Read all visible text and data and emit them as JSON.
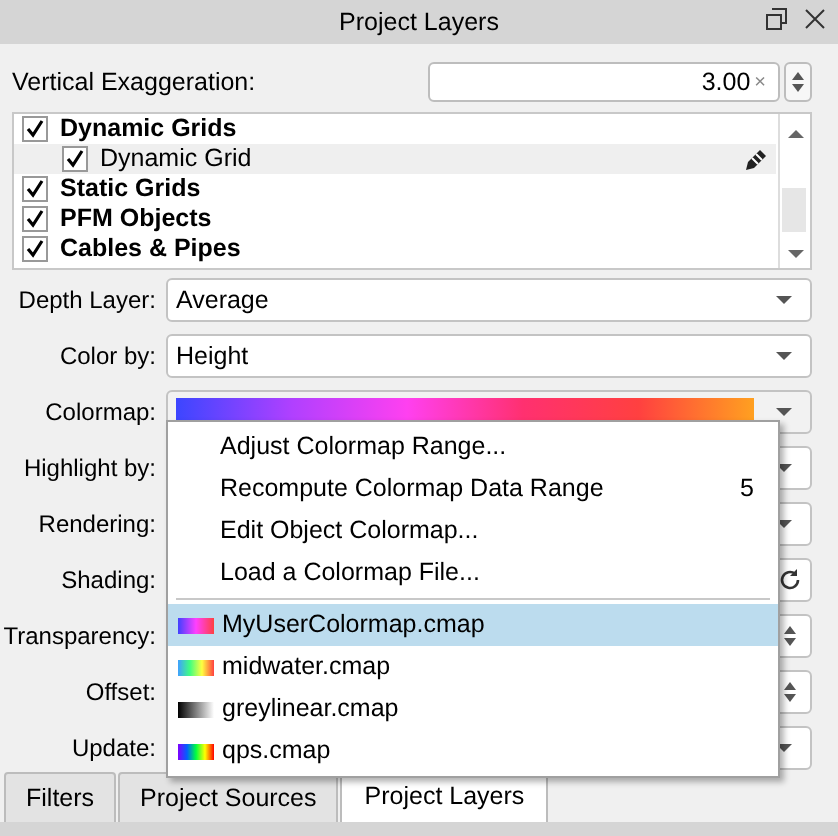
{
  "window": {
    "title": "Project Layers"
  },
  "vertical_exaggeration": {
    "label": "Vertical Exaggeration:",
    "value": "3.00",
    "suffix": "×"
  },
  "layers": [
    {
      "label": "Dynamic Grids",
      "checked": true,
      "selected": false,
      "children": [
        {
          "label": "Dynamic Grid",
          "checked": true,
          "selected": true,
          "editable": true
        }
      ]
    },
    {
      "label": "Static Grids",
      "checked": true,
      "selected": false
    },
    {
      "label": "PFM Objects",
      "checked": true,
      "selected": false
    },
    {
      "label": "Cables & Pipes",
      "checked": true,
      "selected": false
    }
  ],
  "fields": [
    {
      "label": "Depth Layer:",
      "kind": "select",
      "value": "Average"
    },
    {
      "label": "Color by:",
      "kind": "select",
      "value": "Height"
    },
    {
      "label": "Colormap:",
      "kind": "colormap"
    },
    {
      "label": "Highlight by:",
      "kind": "select"
    },
    {
      "label": "Rendering:",
      "kind": "select"
    },
    {
      "label": "Shading:",
      "kind": "refresh"
    },
    {
      "label": "Transparency:",
      "kind": "spin"
    },
    {
      "label": "Offset:",
      "kind": "spin"
    },
    {
      "label": "Update:",
      "kind": "select"
    }
  ],
  "colormap_menu": {
    "actions": [
      {
        "label": "Adjust Colormap Range..."
      },
      {
        "label": "Recompute Colormap Data Range",
        "shortcut": "5"
      },
      {
        "label": "Edit Object Colormap..."
      },
      {
        "label": "Load a Colormap File..."
      }
    ],
    "files": [
      {
        "label": "MyUserColormap.cmap",
        "selected": true,
        "kind": "magenta"
      },
      {
        "label": "midwater.cmap",
        "selected": false,
        "kind": "spectrum"
      },
      {
        "label": "greylinear.cmap",
        "selected": false,
        "kind": "grey"
      },
      {
        "label": "qps.cmap",
        "selected": false,
        "kind": "rainbow"
      }
    ]
  },
  "tabs": [
    {
      "label": "Filters",
      "selected": false
    },
    {
      "label": "Project Sources",
      "selected": false
    },
    {
      "label": "Project Layers",
      "selected": true
    }
  ]
}
